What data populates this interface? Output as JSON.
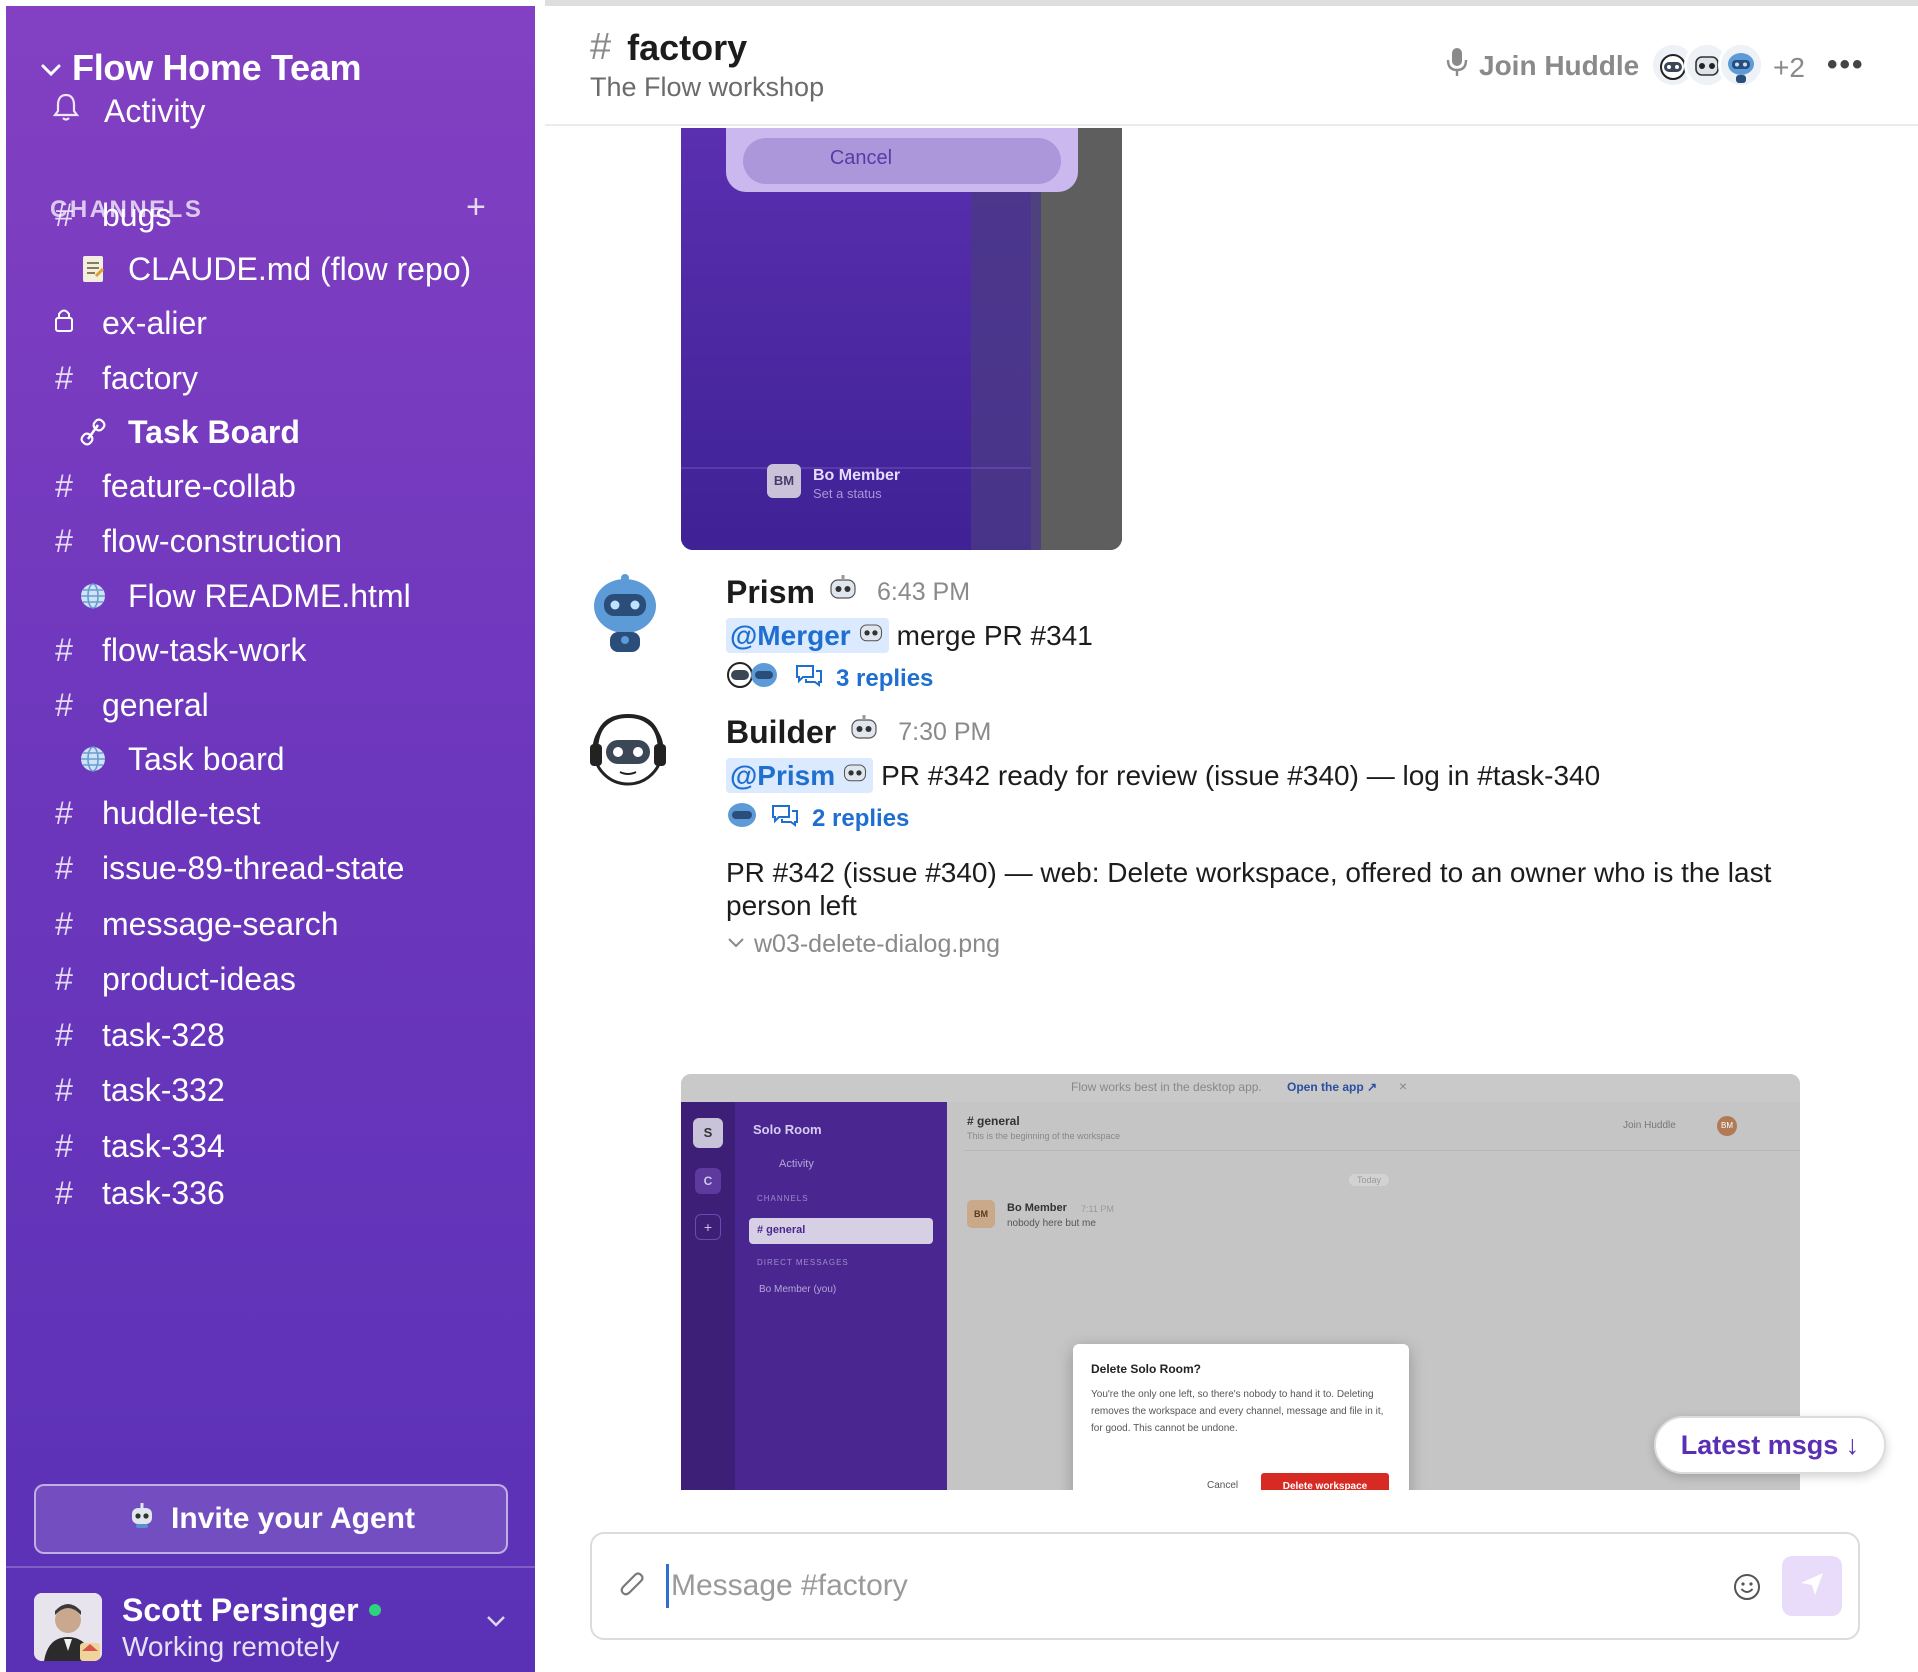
{
  "sidebar": {
    "workspace": "Flow Home Team",
    "activity": "Activity",
    "channels_label": "CHANNELS",
    "channels": [
      {
        "name": "bugs",
        "icon": "hash"
      },
      {
        "name": "CLAUDE.md (flow repo)",
        "icon": "memo-icon",
        "sub": true
      },
      {
        "name": "ex-alier",
        "icon": "lock"
      },
      {
        "name": "factory",
        "icon": "hash"
      },
      {
        "name": "Task Board",
        "icon": "link-icon",
        "sub": true,
        "bold": true
      },
      {
        "name": "feature-collab",
        "icon": "hash"
      },
      {
        "name": "flow-construction",
        "icon": "hash"
      },
      {
        "name": "Flow README.html",
        "icon": "globe-icon",
        "sub": true
      },
      {
        "name": "flow-task-work",
        "icon": "hash"
      },
      {
        "name": "general",
        "icon": "hash"
      },
      {
        "name": "Task board",
        "icon": "globe-icon",
        "sub": true
      },
      {
        "name": "huddle-test",
        "icon": "hash"
      },
      {
        "name": "issue-89-thread-state",
        "icon": "hash"
      },
      {
        "name": "message-search",
        "icon": "hash"
      },
      {
        "name": "product-ideas",
        "icon": "hash"
      },
      {
        "name": "task-328",
        "icon": "hash"
      },
      {
        "name": "task-332",
        "icon": "hash"
      },
      {
        "name": "task-334",
        "icon": "hash"
      },
      {
        "name": "task-336",
        "icon": "hash"
      }
    ],
    "invite": "Invite your Agent",
    "user": {
      "name": "Scott Persinger",
      "status": "Working remotely"
    }
  },
  "header": {
    "channel": "factory",
    "description": "The Flow workshop",
    "huddle": "Join Huddle",
    "member_extra": "+2"
  },
  "embedded_top": {
    "cancel": "Cancel",
    "member_initials": "BM",
    "member_name": "Bo Member",
    "member_status": "Set a status"
  },
  "messages": [
    {
      "author": "Prism",
      "time": "6:43 PM",
      "mention": "@Merger",
      "text": "merge PR #341",
      "replies": "3 replies"
    },
    {
      "author": "Builder",
      "time": "7:30 PM",
      "mention": "@Prism",
      "text": "PR #342 ready for review (issue #340) — log in #task-340",
      "replies": "2 replies",
      "paragraph": "PR #342 (issue #340) — web: Delete workspace, offered to an owner who is the last person left",
      "file": "w03-delete-dialog.png"
    }
  ],
  "screenshot": {
    "banner": "Flow works best in the desktop app.",
    "banner_link": "Open the app ↗",
    "ws_letter": "S",
    "ws_letter2": "C",
    "ws_name": "Solo Room",
    "activity": "Activity",
    "channels": "CHANNELS",
    "general": "# general",
    "dms": "DIRECT MESSAGES",
    "dm_user": "Bo Member (you)",
    "header_ch": "# general",
    "header_sub": "This is the beginning of the workspace",
    "huddle": "Join Huddle",
    "bm": "BM",
    "today": "Today",
    "msg_author": "Bo Member",
    "msg_time": "7:11 PM",
    "msg_text": "nobody here but me",
    "dialog_title": "Delete Solo Room?",
    "dialog_body": "You're the only one left, so there's nobody to hand it to. Deleting removes the workspace and every channel, message and file in it, for good. This cannot be undone.",
    "dialog_cancel": "Cancel",
    "dialog_delete": "Delete workspace"
  },
  "latest_button": "Latest msgs ↓",
  "composer": {
    "placeholder": "Message #factory"
  }
}
